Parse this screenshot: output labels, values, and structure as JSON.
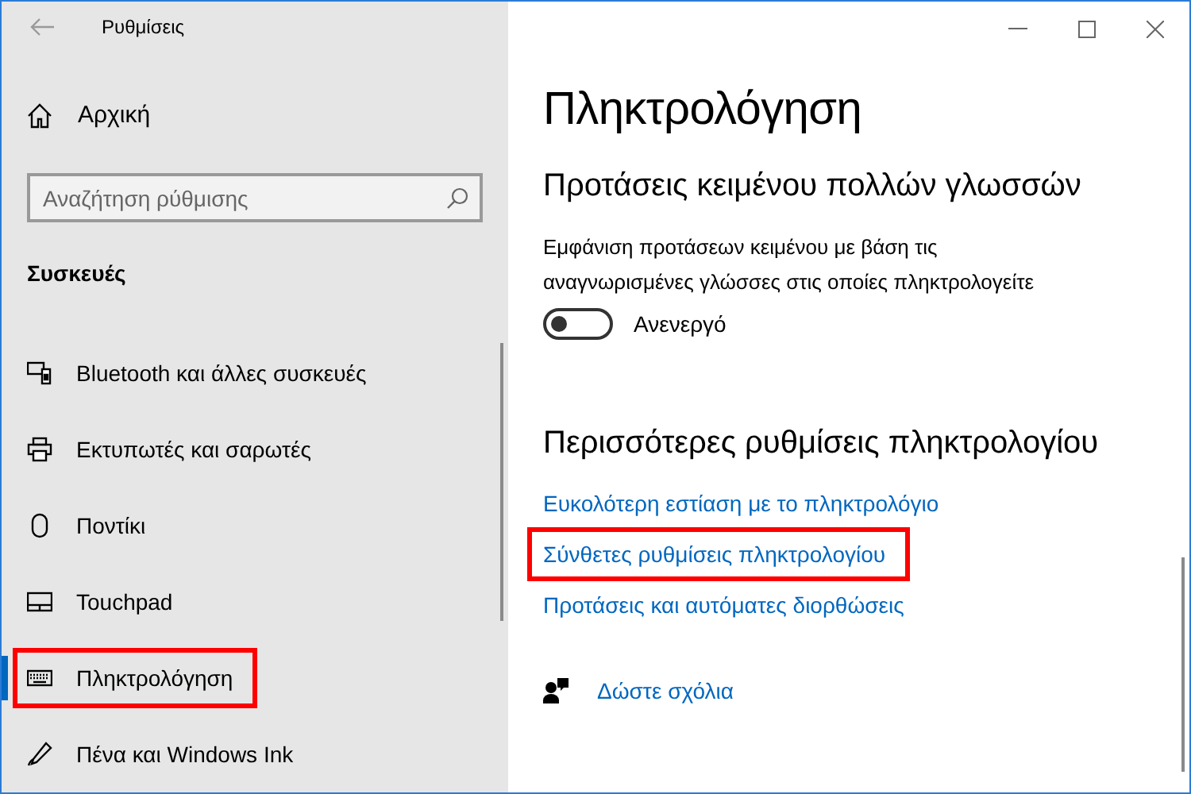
{
  "window": {
    "title": "Ρυθμίσεις"
  },
  "sidebar": {
    "home": "Αρχική",
    "search": {
      "placeholder": "Αναζήτηση ρύθμισης"
    },
    "section": "Συσκευές",
    "items": [
      {
        "label": "Bluetooth και άλλες συσκευές",
        "selected": false,
        "highlighted": false
      },
      {
        "label": "Εκτυπωτές και σαρωτές",
        "selected": false,
        "highlighted": false
      },
      {
        "label": "Ποντίκι",
        "selected": false,
        "highlighted": false
      },
      {
        "label": "Touchpad",
        "selected": false,
        "highlighted": false
      },
      {
        "label": "Πληκτρολόγηση",
        "selected": true,
        "highlighted": true
      },
      {
        "label": "Πένα και Windows Ink",
        "selected": false,
        "highlighted": false
      }
    ]
  },
  "page": {
    "title": "Πληκτρολόγηση",
    "sections": [
      {
        "heading": "Προτάσεις κειμένου πολλών γλωσσών",
        "description": "Εμφάνιση προτάσεων κειμένου με βάση τις αναγνωρισμένες γλώσσες στις οποίες πληκτρολογείτε",
        "toggle": {
          "on": false,
          "label": "Ανενεργό"
        }
      },
      {
        "heading": "Περισσότερες ρυθμίσεις πληκτρολογίου",
        "links": [
          {
            "label": "Ευκολότερη εστίαση με το πληκτρολόγιο",
            "highlighted": false
          },
          {
            "label": "Σύνθετες ρυθμίσεις πληκτρολογίου",
            "highlighted": true
          },
          {
            "label": "Προτάσεις και αυτόματες διορθώσεις",
            "highlighted": false
          }
        ]
      }
    ],
    "feedback": "Δώστε σχόλια"
  }
}
